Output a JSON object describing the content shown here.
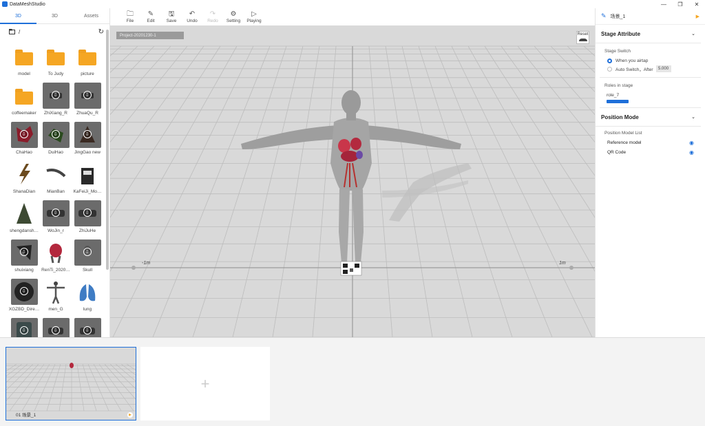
{
  "app": {
    "title": "DataMeshStudio"
  },
  "window_controls": {
    "minimize": "—",
    "maximize": "❐",
    "close": "✕"
  },
  "left_panel": {
    "tabs": [
      {
        "label": "3D",
        "active": true
      },
      {
        "label": "3D",
        "active": false
      },
      {
        "label": "Assets",
        "active": false
      }
    ],
    "path": "/",
    "assets": [
      {
        "label": "model",
        "kind": "folder"
      },
      {
        "label": "To Judy",
        "kind": "folder"
      },
      {
        "label": "picture",
        "kind": "folder"
      },
      {
        "label": "coffeemaker",
        "kind": "folder"
      },
      {
        "label": "ZhiXiang_R",
        "kind": "download"
      },
      {
        "label": "ZhuaQu_R",
        "kind": "download"
      },
      {
        "label": "ChaHao",
        "kind": "download"
      },
      {
        "label": "DuiHao",
        "kind": "download"
      },
      {
        "label": "JingGao new",
        "kind": "download"
      },
      {
        "label": "ShanaDian",
        "kind": "model"
      },
      {
        "label": "MianBan",
        "kind": "model"
      },
      {
        "label": "KaFeiJi_Mo…",
        "kind": "model"
      },
      {
        "label": "shengdansh…",
        "kind": "model"
      },
      {
        "label": "WoJin_r",
        "kind": "download"
      },
      {
        "label": "ZhiJuHe",
        "kind": "download"
      },
      {
        "label": "shuixiang",
        "kind": "download"
      },
      {
        "label": "RenTi_2020…",
        "kind": "model"
      },
      {
        "label": "Skull",
        "kind": "download"
      },
      {
        "label": "XGZBD_Dire…",
        "kind": "download"
      },
      {
        "label": "men_G",
        "kind": "model"
      },
      {
        "label": "lung",
        "kind": "model"
      },
      {
        "label": "",
        "kind": "download"
      },
      {
        "label": "",
        "kind": "download"
      },
      {
        "label": "",
        "kind": "download"
      }
    ]
  },
  "toolbar": {
    "file": "File",
    "edit": "Edit",
    "save": "Save",
    "undo": "Undo",
    "redo": "Redo",
    "setting": "Setting",
    "playing": "Playing"
  },
  "viewport": {
    "project_tag": "Project-20201230-1",
    "reset": "Reset",
    "axis_left": "-1m",
    "axis_right": "1m"
  },
  "right_panel": {
    "scene_name": "场景_1",
    "stage_attribute": "Stage Attribute",
    "stage_switch": "Stage Switch",
    "when_airtap": "When you airtap",
    "auto_switch": "Auto Switch，After",
    "auto_after_value": "5.000",
    "roles_in_stage": "Roles in stage",
    "role": "role_7",
    "position_mode": "Position Mode",
    "position_model_list": "Position Model List",
    "models": [
      "Reference model",
      "QR Code"
    ]
  },
  "bottom": {
    "scene_label": "01  场景_1",
    "add": "+"
  },
  "colors": {
    "accent": "#1e6fd9",
    "folder": "#f5a623",
    "viewport": "#d9d9d9"
  }
}
